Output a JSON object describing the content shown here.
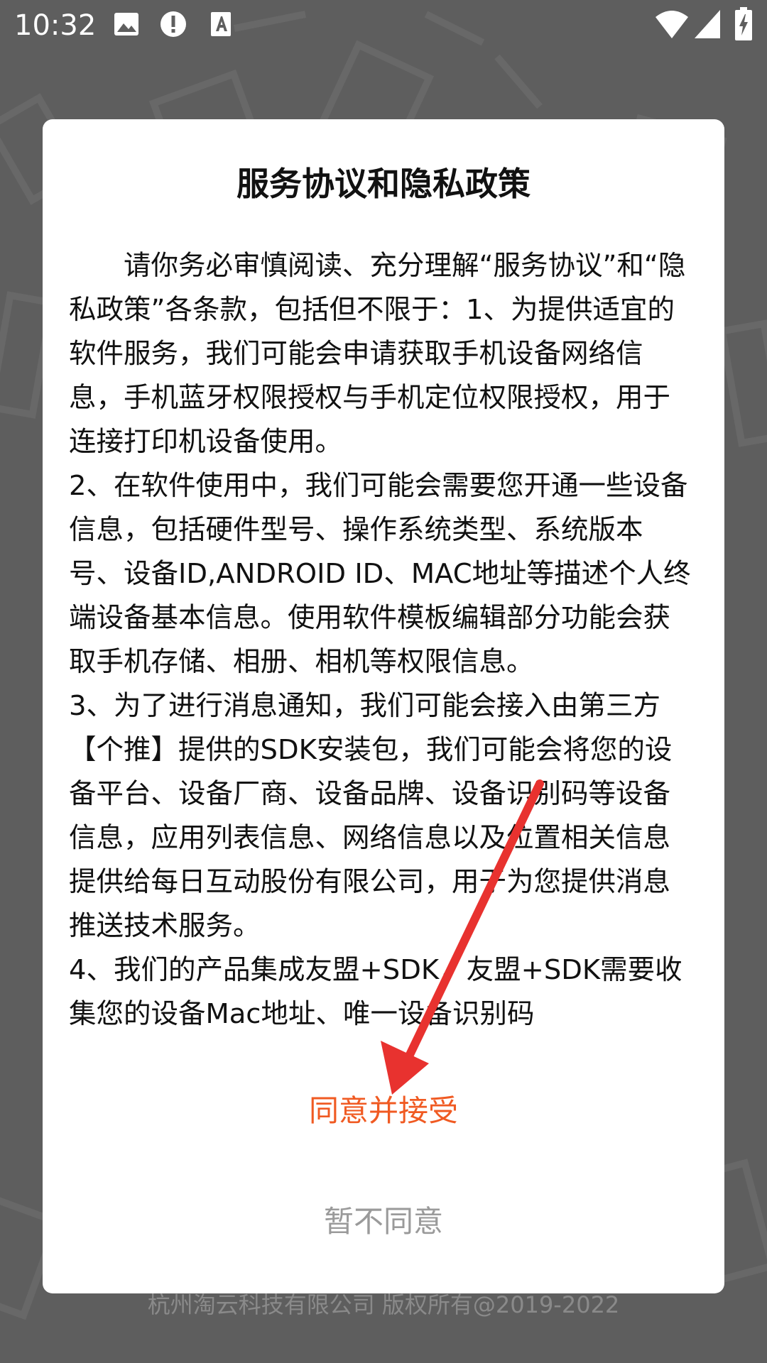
{
  "status_bar": {
    "time": "10:32",
    "icons": [
      "image-icon",
      "alert-icon",
      "a-icon",
      "wifi-icon",
      "signal-icon",
      "battery-icon"
    ]
  },
  "dialog": {
    "title": "服务协议和隐私政策",
    "paragraphs": [
      "请你务必审慎阅读、充分理解“服务协议”和“隐私政策”各条款，包括但不限于：1、为提供适宜的软件服务，我们可能会申请获取手机设备网络信息，手机蓝牙权限授权与手机定位权限授权，用于连接打印机设备使用。",
      "2、在软件使用中，我们可能会需要您开通一些设备信息，包括硬件型号、操作系统类型、系统版本号、设备ID,ANDROID ID、MAC地址等描述个人终端设备基本信息。使用软件模板编辑部分功能会获取手机存储、相册、相机等权限信息。",
      "3、为了进行消息通知，我们可能会接入由第三方【个推】提供的SDK安装包，我们可能会将您的设备平台、设备厂商、设备品牌、设备识别码等设备信息，应用列表信息、网络信息以及位置相关信息提供给每日互动股份有限公司，用于为您提供消息推送技术服务。",
      "4、我们的产品集成友盟+SDK，友盟+SDK需要收集您的设备Mac地址、唯一设备识别码"
    ],
    "accept_label": "同意并接受",
    "decline_label": "暂不同意"
  },
  "footer": {
    "copyright": "杭州淘云科技有限公司 版权所有@2019-2022"
  },
  "colors": {
    "accent": "#f05a22",
    "decline": "#9a9a9a",
    "annotation_arrow": "#e8322f",
    "backdrop": "#5e5e5e"
  }
}
